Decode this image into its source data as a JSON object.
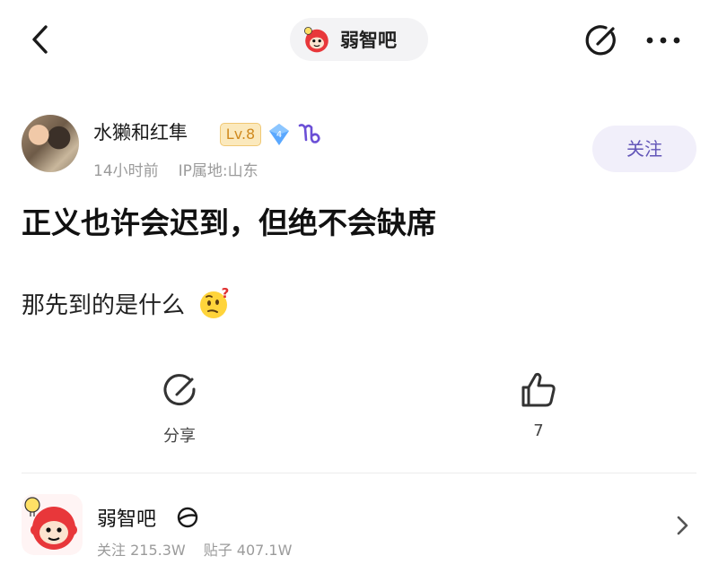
{
  "top_bar": {
    "forum_name": "弱智吧"
  },
  "author": {
    "name": "水獭和红隼",
    "level": "Lv.8",
    "diamond_level": "4",
    "time_ago": "14小时前",
    "ip_location": "IP属地:山东"
  },
  "follow_button": "关注",
  "post": {
    "title": "正义也许会迟到，但绝不会缺席",
    "body": "那先到的是什么"
  },
  "actions": {
    "share_label": "分享",
    "like_count": "7"
  },
  "forum_card": {
    "name": "弱智吧",
    "followers": "关注 215.3W",
    "posts": "贴子 407.1W"
  },
  "colors": {
    "accent": "#6356b8",
    "follow_bg": "#f1effa",
    "level_text": "#d08a1f",
    "forum_logo_red": "#e8373a",
    "meta_gray": "#9b9b9b"
  },
  "icons": {
    "back": "chevron-left-icon",
    "edit": "edit-icon",
    "more": "more-icon",
    "share": "share-icon",
    "like": "thumbs-up-icon",
    "diamond": "diamond-badge-icon",
    "constellation": "capricorn-icon",
    "emoji": "thinking-face-emoji",
    "forum_ring": "ring-icon",
    "forward": "chevron-right-icon"
  }
}
